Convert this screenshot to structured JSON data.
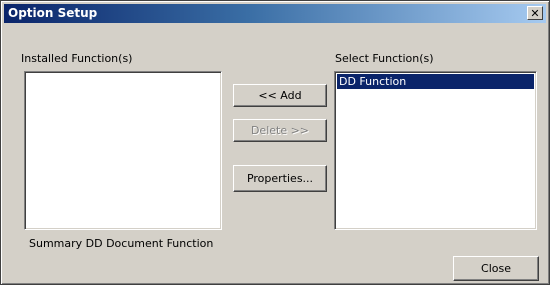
{
  "window": {
    "title": "Option Setup",
    "close_glyph": "✕"
  },
  "installed": {
    "label": "Installed Function(s)",
    "items": []
  },
  "selected": {
    "label": "Select Function(s)",
    "items": [
      "DD Function"
    ]
  },
  "buttons": {
    "add": "<< Add",
    "delete": "Delete >>",
    "properties": "Properties...",
    "close": "Close"
  },
  "summary": "Summary DD Document Function",
  "colors": {
    "title_start": "#0a246a",
    "title_end": "#a6caf0",
    "face": "#d4d0c8",
    "selection": "#0a246a"
  }
}
